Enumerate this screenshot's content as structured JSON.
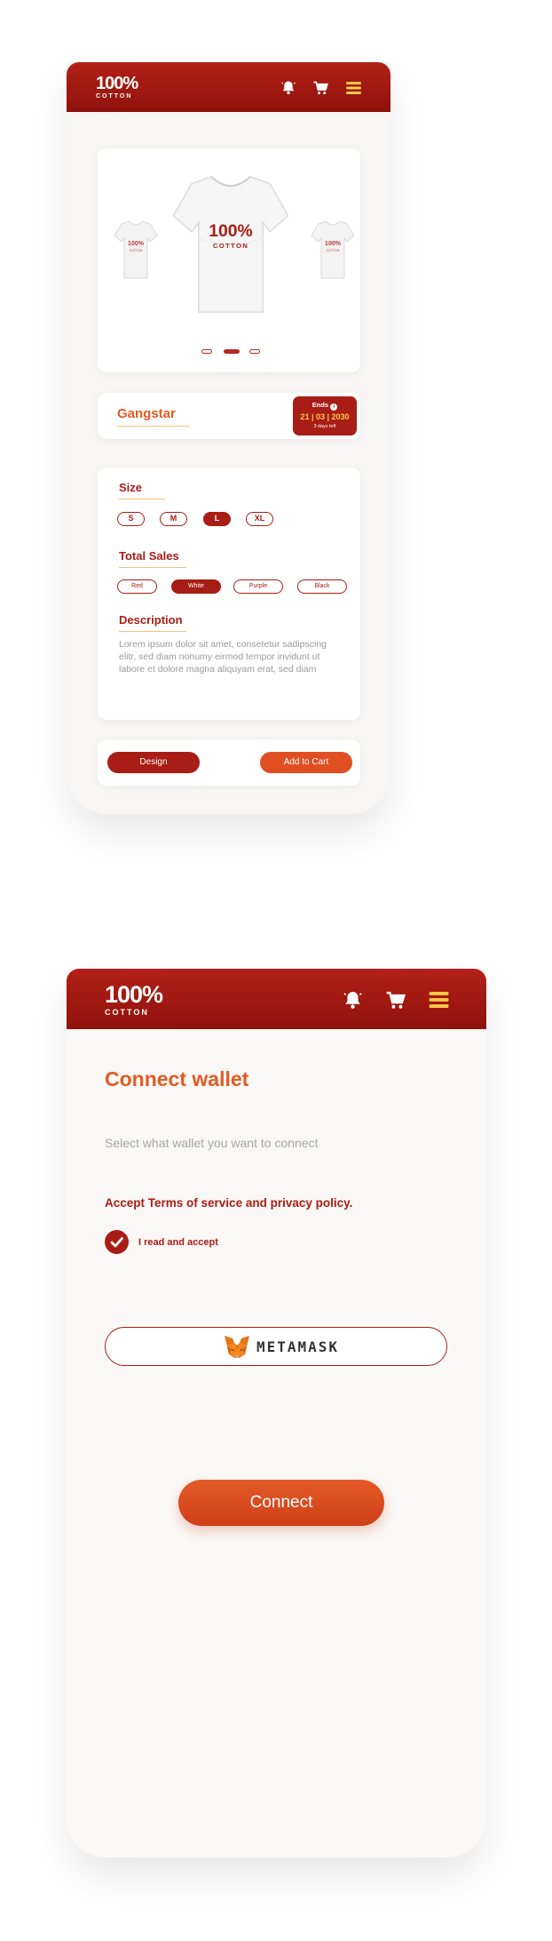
{
  "screen1": {
    "logo": {
      "main": "100%",
      "sub": "COTTON"
    },
    "header_icons": [
      "bell-icon",
      "cart-icon",
      "menu-icon"
    ],
    "product": {
      "name": "Gangstar",
      "shirt_print_main": "100%",
      "shirt_print_sub": "COTTON",
      "countdown": {
        "label": "Ends",
        "date": "21 | 03 | 2030",
        "left": "3 days left"
      }
    },
    "size": {
      "title": "Size",
      "options": [
        "S",
        "M",
        "L",
        "XL"
      ],
      "selected": "L"
    },
    "total_sales": {
      "title": "Total Sales",
      "options": [
        "Red",
        "White",
        "Purple",
        "Black"
      ],
      "selected": "White"
    },
    "description": {
      "title": "Description",
      "text": "Lorem ipsum dolor sit amet, consetetur sadipscing elitr, sed diam nonumy eirmod tempor invidunt ut labore et dolore magna aliquyam erat, sed diam"
    },
    "actions": {
      "design": "Design",
      "add_to_cart": "Add to Cart"
    },
    "colors": {
      "brand_red": "#a81d15",
      "accent_orange": "#e35a22",
      "date_yellow": "#ffc94a"
    }
  },
  "screen2": {
    "logo": {
      "main": "100%",
      "sub": "COTTON"
    },
    "header_icons": [
      "bell-icon",
      "cart-icon",
      "menu-icon"
    ],
    "title": "Connect wallet",
    "subtitle": "Select what wallet you want to connect",
    "terms": "Accept  Terms of service and privacy policy.",
    "checkbox_label": "I read and accept",
    "checkbox_checked": true,
    "wallet_option": "METAMASK",
    "connect_button": "Connect"
  }
}
